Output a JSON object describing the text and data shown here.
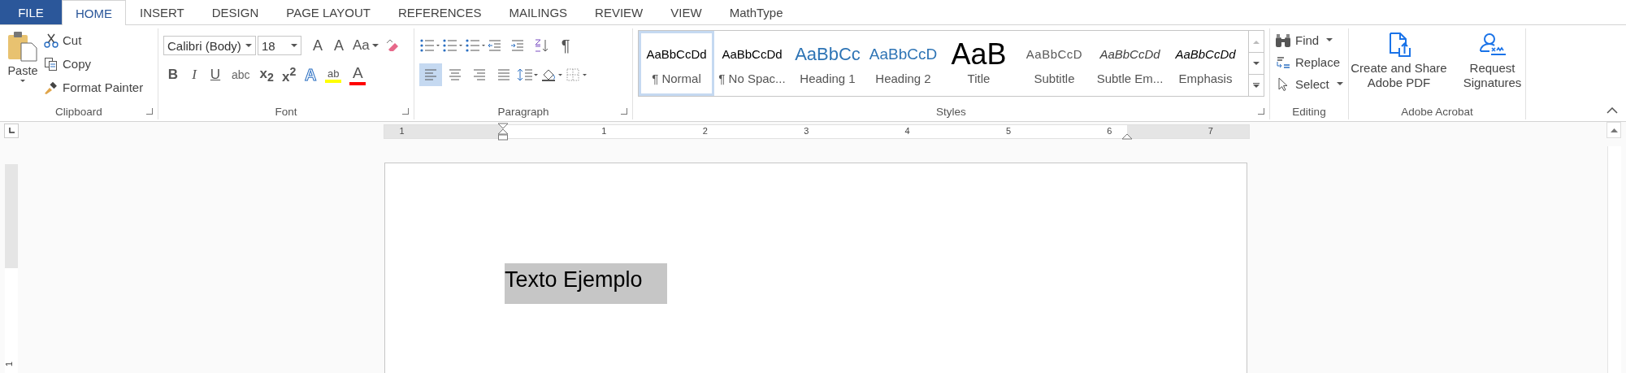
{
  "tabs": [
    {
      "label": "FILE",
      "kind": "file",
      "selected": false
    },
    {
      "label": "HOME",
      "kind": "tab",
      "selected": true
    },
    {
      "label": "INSERT",
      "kind": "tab",
      "selected": false
    },
    {
      "label": "DESIGN",
      "kind": "tab",
      "selected": false
    },
    {
      "label": "PAGE LAYOUT",
      "kind": "tab",
      "selected": false
    },
    {
      "label": "REFERENCES",
      "kind": "tab",
      "selected": false
    },
    {
      "label": "MAILINGS",
      "kind": "tab",
      "selected": false
    },
    {
      "label": "REVIEW",
      "kind": "tab",
      "selected": false
    },
    {
      "label": "VIEW",
      "kind": "tab",
      "selected": false
    },
    {
      "label": "MathType",
      "kind": "tab",
      "selected": false
    }
  ],
  "clipboard": {
    "paste": "Paste",
    "group_label": "Clipboard",
    "actions": [
      {
        "kind": "cut",
        "label": "Cut"
      },
      {
        "kind": "copy",
        "label": "Copy"
      },
      {
        "kind": "painter",
        "label": "Format Painter"
      }
    ]
  },
  "font": {
    "font_name": "Calibri (Body)",
    "font_size": "18",
    "group_label": "Font",
    "row1": [
      {
        "kind": "grow",
        "glyph": "A"
      },
      {
        "kind": "shrink",
        "glyph": "A"
      },
      {
        "kind": "case",
        "glyph": "Aa"
      },
      {
        "kind": "clear"
      }
    ],
    "row2": [
      {
        "kind": "bold",
        "glyph": "B"
      },
      {
        "kind": "italic",
        "glyph": "I"
      },
      {
        "kind": "underline",
        "glyph": "U"
      },
      {
        "kind": "strike",
        "glyph": "abc"
      },
      {
        "kind": "sub",
        "glyph": "x$_{2}$"
      },
      {
        "kind": "sup",
        "glyph": "x$^{2}$"
      },
      {
        "kind": "effects",
        "glyph": "A"
      },
      {
        "kind": "highlight",
        "glyph": "ab",
        "color": "#ffff00"
      },
      {
        "kind": "fontcolor",
        "glyph": "A",
        "color": "#ff0000"
      }
    ]
  },
  "paragraph": {
    "group_label": "Paragraph",
    "row1": [
      {
        "kind": "bullets"
      },
      {
        "kind": "numbering"
      },
      {
        "kind": "multilevel"
      },
      {
        "kind": "outdent"
      },
      {
        "kind": "indent"
      },
      {
        "kind": "sort"
      },
      {
        "kind": "pilcrow",
        "glyph": "¶"
      }
    ],
    "alignment": [
      {
        "kind": "left",
        "selected": true
      },
      {
        "kind": "center",
        "selected": false
      },
      {
        "kind": "right",
        "selected": false
      },
      {
        "kind": "justify",
        "selected": false
      }
    ],
    "row2": [
      {
        "kind": "spacing"
      },
      {
        "kind": "shading"
      },
      {
        "kind": "borders"
      }
    ]
  },
  "styles": {
    "group_label": "Styles",
    "items": [
      {
        "kind": "normal",
        "preview": "AaBbCcDd",
        "label": "¶ Normal",
        "selected": true
      },
      {
        "kind": "nospacing",
        "preview": "AaBbCcDd",
        "label": "¶ No Spac...",
        "selected": false
      },
      {
        "kind": "heading1",
        "preview": "AaBbCc",
        "label": "Heading 1",
        "selected": false
      },
      {
        "kind": "heading2",
        "preview": "AaBbCcD",
        "label": "Heading 2",
        "selected": false
      },
      {
        "kind": "title",
        "preview": "AaB",
        "label": "Title",
        "selected": false
      },
      {
        "kind": "subtitle",
        "preview": "AaBbCcD",
        "label": "Subtitle",
        "selected": false
      },
      {
        "kind": "subtle",
        "preview": "AaBbCcDd",
        "label": "Subtle Em...",
        "selected": false
      },
      {
        "kind": "emphasis",
        "preview": "AaBbCcDd",
        "label": "Emphasis",
        "selected": false
      }
    ]
  },
  "editing": {
    "group_label": "Editing",
    "actions": [
      {
        "kind": "find",
        "label": "Find"
      },
      {
        "kind": "replace",
        "label": "Replace"
      },
      {
        "kind": "select",
        "label": "Select"
      }
    ]
  },
  "acrobat": {
    "group_label": "Adobe Acrobat",
    "actions": [
      {
        "kind": "pdf",
        "label": "Create and Share Adobe PDF"
      },
      {
        "kind": "sign",
        "label": "Request Signatures"
      }
    ]
  },
  "ruler": {
    "labels": [
      "1",
      "1",
      "2",
      "3",
      "4",
      "5",
      "6",
      "7"
    ],
    "vertical_label": "1"
  },
  "document": {
    "text": "Texto Ejemplo",
    "selected": true
  }
}
